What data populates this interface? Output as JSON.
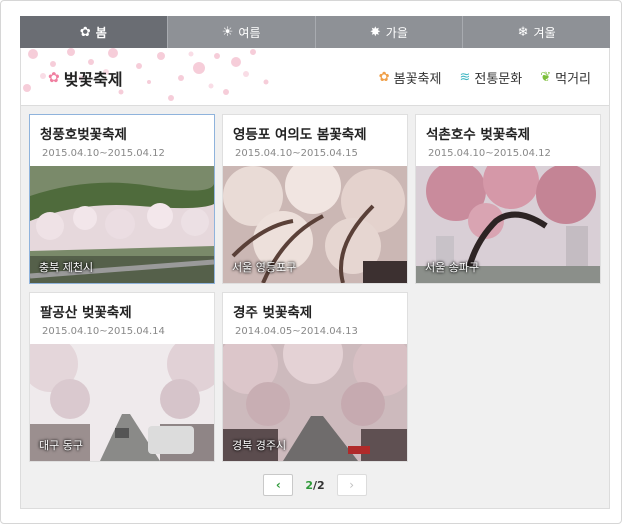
{
  "tabs": [
    {
      "label": "봄",
      "icon": "flower-icon",
      "glyph": "✿",
      "active": true
    },
    {
      "label": "여름",
      "icon": "sun-icon",
      "glyph": "☀",
      "active": false
    },
    {
      "label": "가을",
      "icon": "maple-leaf-icon",
      "glyph": "✸",
      "active": false
    },
    {
      "label": "겨울",
      "icon": "snowflake-icon",
      "glyph": "❄",
      "active": false
    }
  ],
  "banner": {
    "title": "벚꽃축제",
    "links": [
      {
        "label": "봄꽃축제",
        "icon": "flower-icon",
        "glyph": "✿"
      },
      {
        "label": "전통문화",
        "icon": "wave-icon",
        "glyph": "≋"
      },
      {
        "label": "먹거리",
        "icon": "leaf-icon",
        "glyph": "❦"
      }
    ]
  },
  "cards": [
    {
      "title": "청풍호벚꽃축제",
      "date": "2015.04.10~2015.04.12",
      "location": "충북 제천시"
    },
    {
      "title": "영등포 여의도 봄꽃축제",
      "date": "2015.04.10~2015.04.15",
      "location": "서울 영등포구"
    },
    {
      "title": "석촌호수 벚꽃축제",
      "date": "2015.04.10~2015.04.12",
      "location": "서울 송파구"
    },
    {
      "title": "팔공산 벚꽃축제",
      "date": "2015.04.10~2015.04.14",
      "location": "대구 동구"
    },
    {
      "title": "경주 벚꽃축제",
      "date": "2014.04.05~2014.04.13",
      "location": "경북 경주시"
    }
  ],
  "pager": {
    "current": "2",
    "total": "2",
    "prev": "‹",
    "next": "›"
  },
  "colors": {
    "tab": "#8e9196",
    "tab_active": "#6a6d73",
    "blossom": "#f0b8c8",
    "page_current": "#2f9a3a"
  }
}
